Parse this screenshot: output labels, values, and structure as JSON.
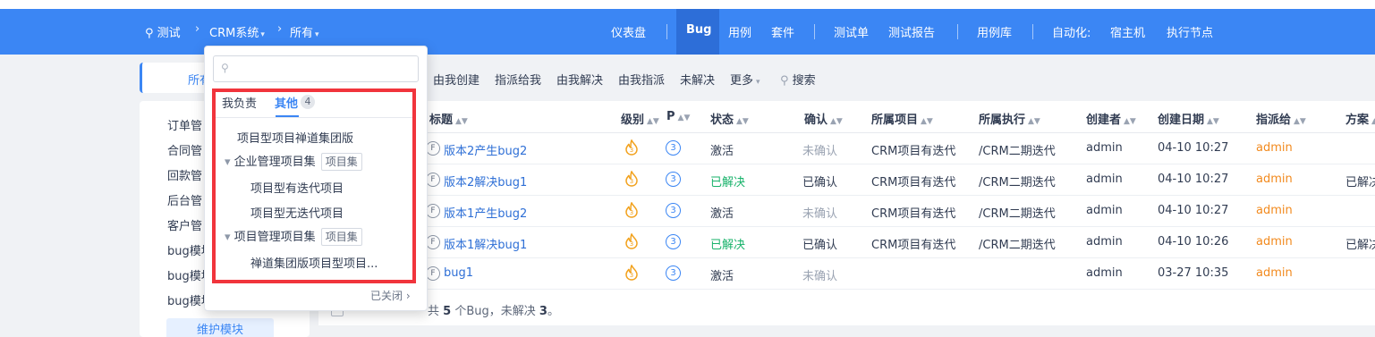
{
  "header": {
    "breadcrumb": {
      "root": "测试",
      "product": "CRM系统",
      "branch": "所有"
    },
    "nav": [
      "仪表盘",
      "Bug",
      "用例",
      "套件",
      "测试单",
      "测试报告",
      "用例库",
      "自动化:",
      "宿主机",
      "执行节点"
    ],
    "active_nav": "Bug"
  },
  "sidebar": {
    "tab_label": "所有",
    "items": [
      "订单管",
      "合同管",
      "回款管",
      "后台管",
      "客户管",
      "bug模块",
      "bug模块",
      "bug模块"
    ],
    "maintain_button": "维护模块"
  },
  "filters": [
    "由我创建",
    "指派给我",
    "由我解决",
    "由我指派",
    "未解决",
    "更多",
    "搜索"
  ],
  "table": {
    "headers": [
      "标题",
      "级别",
      "P",
      "状态",
      "确认",
      "所属项目",
      "所属执行",
      "创建者",
      "创建日期",
      "指派给",
      "方案"
    ],
    "rows": [
      {
        "title": "版本2产生bug2",
        "priority": "3",
        "status": "激活",
        "confirm": "未确认",
        "project": "CRM项目有迭代",
        "execution": "/CRM二期迭代",
        "creator": "admin",
        "date": "04-10 10:27",
        "assignee": "admin",
        "solution": ""
      },
      {
        "title": "版本2解决bug1",
        "priority": "3",
        "status": "已解决",
        "confirm": "已确认",
        "project": "CRM项目有迭代",
        "execution": "/CRM二期迭代",
        "creator": "admin",
        "date": "04-10 10:27",
        "assignee": "admin",
        "solution": "已解决"
      },
      {
        "title": "版本1产生bug2",
        "priority": "3",
        "status": "激活",
        "confirm": "未确认",
        "project": "CRM项目有迭代",
        "execution": "/CRM二期迭代",
        "creator": "admin",
        "date": "04-10 10:27",
        "assignee": "admin",
        "solution": ""
      },
      {
        "title": "版本1解决bug1",
        "priority": "3",
        "status": "已解决",
        "confirm": "已确认",
        "project": "CRM项目有迭代",
        "execution": "/CRM二期迭代",
        "creator": "admin",
        "date": "04-10 10:26",
        "assignee": "admin",
        "solution": "已解决"
      },
      {
        "title": "bug1",
        "priority": "3",
        "status": "激活",
        "confirm": "未确认",
        "project": "",
        "execution": "",
        "creator": "admin",
        "date": "03-27 10:35",
        "assignee": "admin",
        "solution": ""
      }
    ],
    "footer": {
      "prefix": "共",
      "count": "5",
      "mid": "个Bug，未解决",
      "unresolved": "3",
      "suffix": "。"
    }
  },
  "dropdown": {
    "search_placeholder": "",
    "tabs": {
      "mine": "我负责",
      "other": "其他",
      "other_count": "4"
    },
    "items": [
      {
        "label": "项目型项目禅道集团版"
      },
      {
        "label": "企业管理项目集",
        "tag": "项目集"
      },
      {
        "label": "项目型有迭代项目"
      },
      {
        "label": "项目型无迭代项目"
      },
      {
        "label": "项目管理项目集",
        "tag": "项目集"
      },
      {
        "label": "禅道集团版项目型项目..."
      }
    ],
    "closed_link": "已关闭"
  },
  "colors": {
    "brand": "#3b86f4",
    "highlight": "#f1343c",
    "resolved": "#17b26a",
    "assignee": "#f28a1e"
  }
}
